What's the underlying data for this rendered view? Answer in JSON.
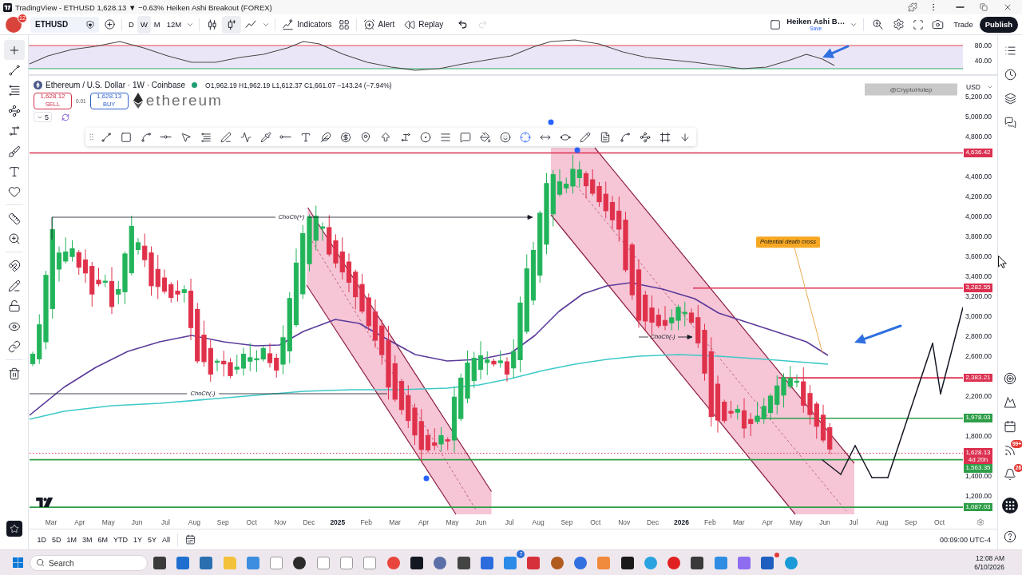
{
  "title_bar": {
    "title": "TradingView - ETHUSD 1,628.13 ▼ −0.63% Heiken Ashi Breakout (FOREX)"
  },
  "toolbar": {
    "avatar_badge": "12",
    "symbol": "ETHUSD",
    "intervals": [
      {
        "label": "D",
        "selected": false
      },
      {
        "label": "W",
        "selected": true
      },
      {
        "label": "M",
        "selected": false
      },
      {
        "label": "12M",
        "selected": false
      }
    ],
    "chart_types": [
      {
        "kind": "bars",
        "selected": false
      },
      {
        "kind": "heikin",
        "selected": true
      },
      {
        "kind": "line",
        "selected": false
      }
    ],
    "indicators": "Indicators",
    "alert": "Alert",
    "replay": "Replay",
    "history": [
      {
        "kind": "undo",
        "disabled": false
      },
      {
        "kind": "redo",
        "disabled": true
      }
    ],
    "layout": {
      "name": "Heiken Ashi B…",
      "status": "Save"
    },
    "trade": "Trade",
    "publish": "Publish"
  },
  "left_toolbar": {
    "groups": [
      {
        "tools": [
          {
            "kind": "crosshair",
            "selected": true
          },
          {
            "kind": "trendline",
            "selected": false
          },
          {
            "kind": "fib",
            "selected": false
          },
          {
            "kind": "pattern",
            "selected": false
          },
          {
            "kind": "projection",
            "selected": false
          },
          {
            "kind": "brush",
            "selected": false
          },
          {
            "kind": "text",
            "selected": false
          },
          {
            "kind": "favorites",
            "selected": false
          }
        ]
      },
      {
        "tools": [
          {
            "kind": "measure",
            "selected": false
          },
          {
            "kind": "zoom",
            "selected": false
          }
        ]
      },
      {
        "tools": [
          {
            "kind": "magnet",
            "selected": false
          },
          {
            "kind": "stay",
            "selected": false
          },
          {
            "kind": "lock",
            "selected": false
          },
          {
            "kind": "visibility",
            "selected": false
          },
          {
            "kind": "link",
            "selected": false
          }
        ]
      },
      {
        "tools": [
          {
            "kind": "remove",
            "selected": false
          }
        ]
      }
    ]
  },
  "oscillator": {
    "levels": [
      "80.00",
      "40.00"
    ]
  },
  "chart": {
    "legend": {
      "title": "Ethereum / U.S. Dollar · 1W · Coinbase",
      "ohlc": "O1,962.19 H1,962.19 L1,612.37 C1,661.07 −143.24 (−7.94%)"
    },
    "sell": {
      "price": "1,628.12",
      "label": "SELL"
    },
    "spread": "0.01",
    "buy": {
      "price": "1,628.13",
      "label": "BUY"
    },
    "indicator_count": "5",
    "watermark": "ethereum",
    "labels": [
      {
        "kind": "choch",
        "text": "ChoCh(+)"
      },
      {
        "kind": "choch",
        "text": "ChoCh(-)"
      },
      {
        "kind": "choch",
        "text": "ChoCh(-)"
      },
      {
        "kind": "callout",
        "text": "Potential death cross"
      },
      {
        "kind": "signature",
        "text": "@CryptoHotep"
      }
    ],
    "price_scale": {
      "currency": "USD",
      "ticks": [
        "5,200.00",
        "5,000.00",
        "4,800.00",
        "4,400.00",
        "4,200.00",
        "4,000.00",
        "3,800.00",
        "3,600.00",
        "3,400.00",
        "3,200.00",
        "3,000.00",
        "2,800.00",
        "2,600.00",
        "2,200.00",
        "1,800.00",
        "1,400.00",
        "1,200.00"
      ],
      "tags": [
        {
          "value": "4,636.42",
          "kind": "level",
          "color": "#dc3050"
        },
        {
          "value": "3,282.55",
          "kind": "level",
          "color": "#dc3050"
        },
        {
          "value": "2,383.21",
          "kind": "level",
          "color": "#dc3050"
        },
        {
          "value": "1,978.03",
          "kind": "level",
          "color": "#2e9e48"
        },
        {
          "value": "1,628.13",
          "note": "4d 20h",
          "kind": "last",
          "color": "#dc3050"
        },
        {
          "value": "1,563.35",
          "kind": "level",
          "color": "#2e9e48"
        },
        {
          "value": "1,087.03",
          "kind": "level",
          "color": "#2e9e48"
        }
      ]
    },
    "time_axis": [
      {
        "label": "Mar",
        "kind": "month"
      },
      {
        "label": "Apr",
        "kind": "month"
      },
      {
        "label": "May",
        "kind": "month"
      },
      {
        "label": "Jun",
        "kind": "month"
      },
      {
        "label": "Jul",
        "kind": "month"
      },
      {
        "label": "Aug",
        "kind": "month"
      },
      {
        "label": "Sep",
        "kind": "month"
      },
      {
        "label": "Oct",
        "kind": "month"
      },
      {
        "label": "Nov",
        "kind": "month"
      },
      {
        "label": "Dec",
        "kind": "month"
      },
      {
        "label": "2025",
        "kind": "year"
      },
      {
        "label": "Feb",
        "kind": "month"
      },
      {
        "label": "Mar",
        "kind": "month"
      },
      {
        "label": "Apr",
        "kind": "month"
      },
      {
        "label": "May",
        "kind": "month"
      },
      {
        "label": "Jun",
        "kind": "month"
      },
      {
        "label": "Jul",
        "kind": "month"
      },
      {
        "label": "Aug",
        "kind": "month"
      },
      {
        "label": "Sep",
        "kind": "month"
      },
      {
        "label": "Oct",
        "kind": "month"
      },
      {
        "label": "Nov",
        "kind": "month"
      },
      {
        "label": "Dec",
        "kind": "month"
      },
      {
        "label": "2026",
        "kind": "year"
      },
      {
        "label": "Feb",
        "kind": "month"
      },
      {
        "label": "Mar",
        "kind": "month"
      },
      {
        "label": "Apr",
        "kind": "month"
      },
      {
        "label": "May",
        "kind": "month"
      },
      {
        "label": "Jun",
        "kind": "month"
      },
      {
        "label": "Jul",
        "kind": "month"
      },
      {
        "label": "Aug",
        "kind": "month"
      },
      {
        "label": "Sep",
        "kind": "month"
      },
      {
        "label": "Oct",
        "kind": "month"
      }
    ]
  },
  "bottom_bar": {
    "ranges": [
      "1D",
      "5D",
      "1M",
      "3M",
      "6M",
      "YTD",
      "1Y",
      "5Y",
      "All"
    ],
    "clock": "00:09:00 UTC-4"
  },
  "right_sidebar": {
    "feed_badge": "99+",
    "alerts_badge": "26"
  },
  "taskbar": {
    "search": {
      "placeholder": "Search"
    },
    "app_badge": "7",
    "time": "12:08 AM",
    "date": "6/10/2026"
  }
}
